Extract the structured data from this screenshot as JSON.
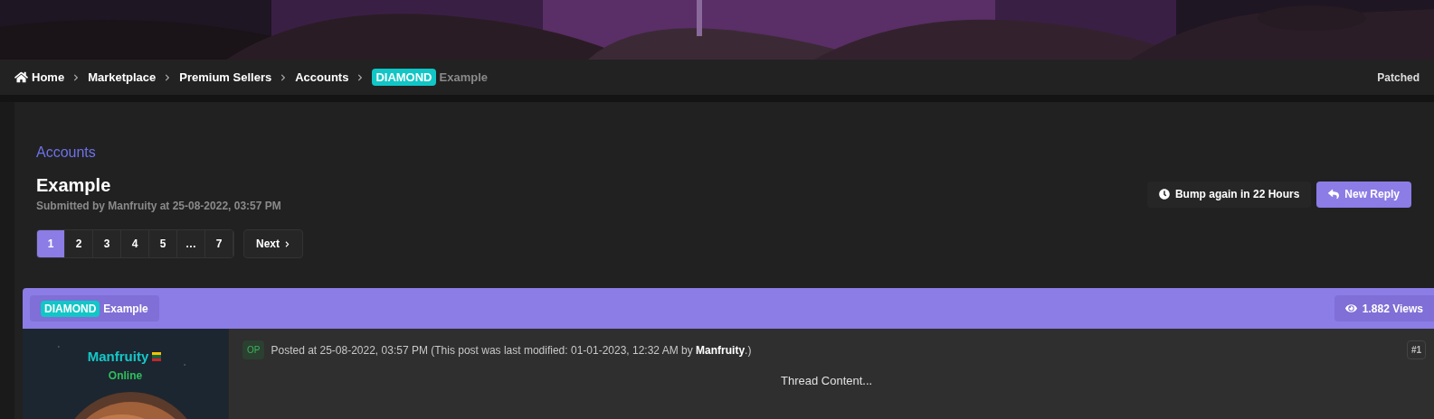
{
  "breadcrumbs": [
    {
      "label": "Home",
      "kind": "home"
    },
    {
      "label": "Marketplace"
    },
    {
      "label": "Premium Sellers"
    },
    {
      "label": "Accounts"
    }
  ],
  "breadcrumb_current": {
    "prefix": "DIAMOND",
    "title": "Example"
  },
  "breadcrumb_right": "Patched",
  "thread": {
    "forum": "Accounts",
    "title": "Example",
    "submitted": "Submitted by Manfruity at 25-08-2022, 03:57 PM",
    "bump": "Bump again in 22 Hours",
    "new_reply": "New Reply"
  },
  "pages": [
    {
      "label": "1",
      "selected": true
    },
    {
      "label": "2",
      "selected": false
    },
    {
      "label": "3",
      "selected": false
    },
    {
      "label": "4",
      "selected": false
    },
    {
      "label": "5",
      "selected": false
    },
    {
      "label": "…",
      "selected": false
    },
    {
      "label": "7",
      "selected": false
    }
  ],
  "next": "Next",
  "post_header": {
    "prefix": "DIAMOND",
    "title": "Example",
    "views": "1.882 Views"
  },
  "post": {
    "author": "Manfruity",
    "status": "Online",
    "badge": "OP",
    "meta": "Posted at 25-08-2022, 03:57 PM (This post was last modified: 01-01-2023, 12:32 AM by **Manfruity**.)",
    "number": "#1",
    "content": "Thread Content..."
  }
}
